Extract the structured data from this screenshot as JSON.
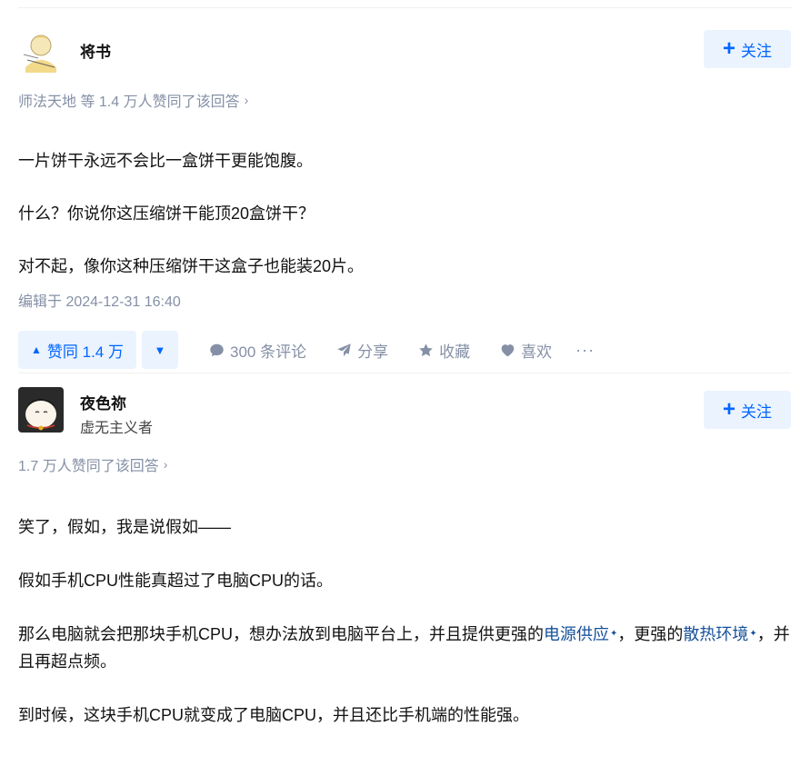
{
  "answers": [
    {
      "author_name": "将书",
      "follow_label": "关注",
      "voters_text": "师法天地 等 1.4 万人赞同了该回答",
      "paragraphs": [
        "一片饼干永远不会比一盒饼干更能饱腹。",
        "什么？你说你这压缩饼干能顶20盒饼干？",
        "对不起，像你这种压缩饼干这盒子也能装20片。"
      ],
      "edited_text": "编辑于 2024-12-31 16:40",
      "actions": {
        "vote_up_label": "赞同 1.4 万",
        "comment_label": "300 条评论",
        "share_label": "分享",
        "collect_label": "收藏",
        "like_label": "喜欢",
        "more_label": "···"
      }
    },
    {
      "author_name": "夜色祢",
      "author_bio": "虚无主义者",
      "follow_label": "关注",
      "voters_text": "1.7 万人赞同了该回答",
      "paragraphs": [
        "笑了，假如，我是说假如——",
        "假如手机CPU性能真超过了电脑CPU的话。",
        "到时候，这块手机CPU就变成了电脑CPU，并且还比手机端的性能强。"
      ],
      "para3": {
        "t1": "那么电脑就会把那块手机CPU，想办法放到电脑平台上，并且提供更强的",
        "link1": "电源供应",
        "t2": "，更强的",
        "link2": "散热环境",
        "t3": "，并且再超点频。"
      }
    }
  ],
  "colors": {
    "accent": "#0066ff",
    "accent_bg": "#ebf3ff",
    "meta_gray": "#8590a6",
    "link": "#175199"
  },
  "icons": [
    "plus-icon",
    "chevron-right-icon",
    "triangle-up-icon",
    "triangle-down-icon",
    "comment-icon",
    "share-icon",
    "star-icon",
    "heart-icon",
    "ellipsis-icon"
  ]
}
